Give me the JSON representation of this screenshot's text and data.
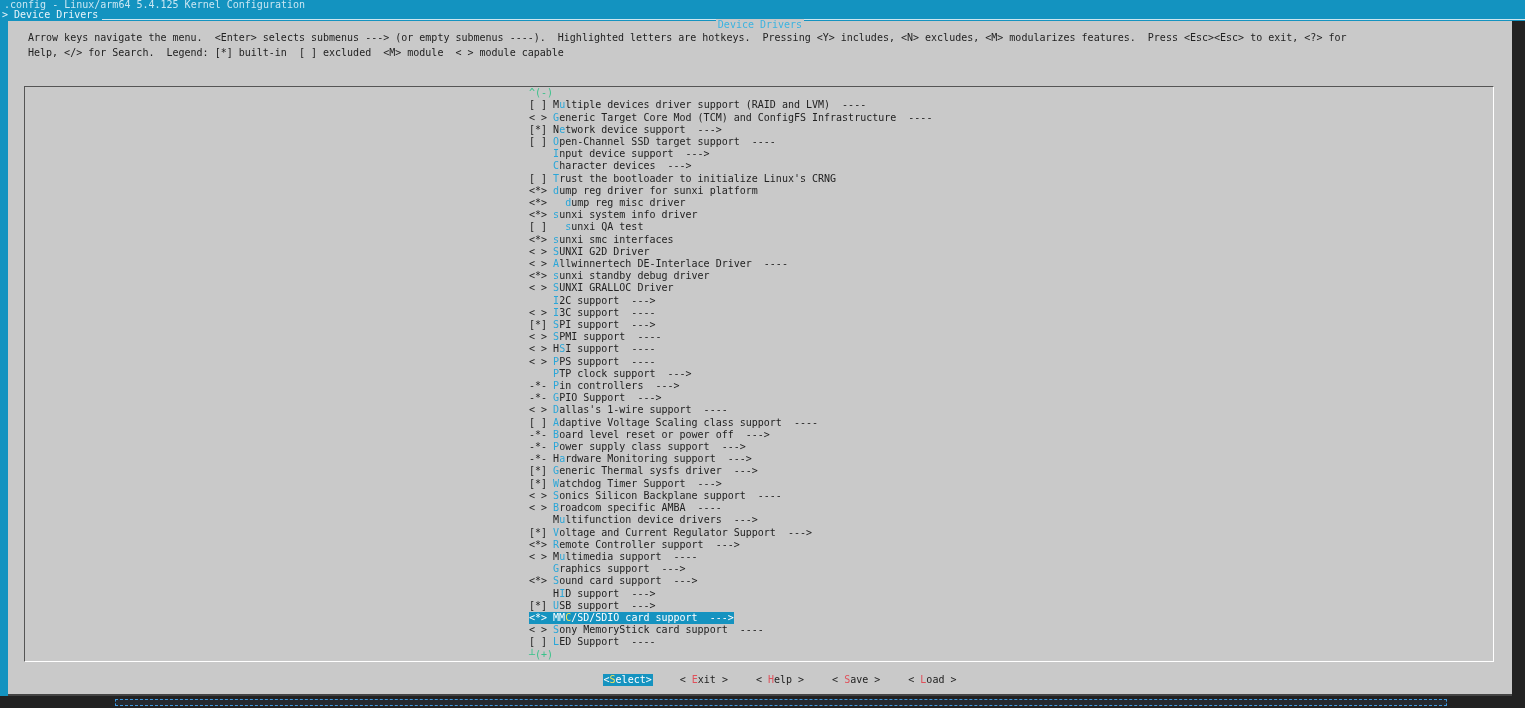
{
  "window": {
    "title": ".config - Linux/arm64 5.4.125 Kernel Configuration",
    "breadcrumb": "> Device Drivers"
  },
  "dialog": {
    "title": "Device Drivers",
    "help_lines": [
      "Arrow keys navigate the menu.  <Enter> selects submenus ---> (or empty submenus ----).  Highlighted letters are hotkeys.  Pressing <Y> includes, <N> excludes, <M> modularizes features.  Press <Esc><Esc> to exit, <?> for",
      "Help, </> for Search.  Legend: [*] built-in  [ ] excluded  <M> module  < > module capable"
    ]
  },
  "menu": {
    "scroll_up": "^(-)",
    "scroll_down": "┴(+)",
    "items": [
      {
        "state": "[ ]",
        "pre": "M",
        "hotkey": "u",
        "rest": "ltiple devices driver support (RAID and LVM)  ----",
        "selected": false
      },
      {
        "state": "< >",
        "hotkey": "G",
        "rest": "eneric Target Core Mod (TCM) and ConfigFS Infrastructure  ----",
        "selected": false
      },
      {
        "state": "[*]",
        "pre": "N",
        "hotkey": "e",
        "rest": "twork device support  --->",
        "selected": false
      },
      {
        "state": "[ ]",
        "hotkey": "O",
        "rest": "pen-Channel SSD target support  ----",
        "selected": false
      },
      {
        "hotkey": "I",
        "rest": "nput device support  --->",
        "selected": false
      },
      {
        "hotkey": "C",
        "rest": "haracter devices  --->",
        "selected": false
      },
      {
        "state": "[ ]",
        "hotkey": "T",
        "rest": "rust the bootloader to initialize Linux's CRNG",
        "selected": false
      },
      {
        "state": "<*>",
        "hotkey": "d",
        "rest": "ump reg driver for sunxi platform",
        "selected": false,
        "children": [
          {
            "state": "<*>",
            "hotkey": "d",
            "rest": "ump reg misc driver",
            "selected": false
          }
        ]
      },
      {
        "state": "<*>",
        "hotkey": "s",
        "rest": "unxi system info driver",
        "selected": false,
        "children": [
          {
            "state": "[ ]",
            "hotkey": "s",
            "rest": "unxi QA test",
            "selected": false
          }
        ]
      },
      {
        "state": "<*>",
        "hotkey": "s",
        "rest": "unxi smc interfaces",
        "selected": false
      },
      {
        "state": "< >",
        "hotkey": "S",
        "rest": "UNXI G2D Driver",
        "selected": false
      },
      {
        "state": "< >",
        "hotkey": "A",
        "rest": "llwinnertech DE-Interlace Driver  ----",
        "selected": false
      },
      {
        "state": "<*>",
        "hotkey": "s",
        "rest": "unxi standby debug driver",
        "selected": false
      },
      {
        "state": "< >",
        "hotkey": "S",
        "rest": "UNXI GRALLOC Driver",
        "selected": false
      },
      {
        "hotkey": "I",
        "rest": "2C support  --->",
        "selected": false
      },
      {
        "state": "< >",
        "hotkey": "I",
        "rest": "3C support  ----",
        "selected": false
      },
      {
        "state": "[*]",
        "hotkey": "S",
        "rest": "PI support  --->",
        "selected": false
      },
      {
        "state": "< >",
        "hotkey": "S",
        "rest": "PMI support  ----",
        "selected": false
      },
      {
        "state": "< >",
        "pre": "H",
        "hotkey": "S",
        "rest": "I support  ----",
        "selected": false
      },
      {
        "state": "< >",
        "hotkey": "P",
        "rest": "PS support  ----",
        "selected": false
      },
      {
        "hotkey": "P",
        "rest": "TP clock support  --->",
        "selected": false
      },
      {
        "state": "-*-",
        "hotkey": "P",
        "rest": "in controllers  --->",
        "selected": false
      },
      {
        "state": "-*-",
        "hotkey": "G",
        "rest": "PIO Support  --->",
        "selected": false
      },
      {
        "state": "< >",
        "hotkey": "D",
        "rest": "allas's 1-wire support  ----",
        "selected": false
      },
      {
        "state": "[ ]",
        "hotkey": "A",
        "rest": "daptive Voltage Scaling class support  ----",
        "selected": false
      },
      {
        "state": "-*-",
        "hotkey": "B",
        "rest": "oard level reset or power off  --->",
        "selected": false
      },
      {
        "state": "-*-",
        "hotkey": "P",
        "rest": "ower supply class support  --->",
        "selected": false
      },
      {
        "state": "-*-",
        "pre": "H",
        "hotkey": "a",
        "rest": "rdware Monitoring support  --->",
        "selected": false
      },
      {
        "state": "[*]",
        "hotkey": "G",
        "rest": "eneric Thermal sysfs driver  --->",
        "selected": false
      },
      {
        "state": "[*]",
        "hotkey": "W",
        "rest": "atchdog Timer Support  --->",
        "selected": false
      },
      {
        "state": "< >",
        "hotkey": "S",
        "rest": "onics Silicon Backplane support  ----",
        "selected": false
      },
      {
        "state": "< >",
        "hotkey": "B",
        "rest": "roadcom specific AMBA  ----",
        "selected": false
      },
      {
        "pre": "M",
        "hotkey": "u",
        "rest": "ltifunction device drivers  --->",
        "selected": false
      },
      {
        "state": "[*]",
        "hotkey": "V",
        "rest": "oltage and Current Regulator Support  --->",
        "selected": false
      },
      {
        "state": "<*>",
        "hotkey": "R",
        "rest": "emote Controller support  --->",
        "selected": false
      },
      {
        "state": "< >",
        "pre": "M",
        "hotkey": "u",
        "rest": "ltimedia support  ----",
        "selected": false
      },
      {
        "hotkey": "G",
        "rest": "raphics support  --->",
        "selected": false
      },
      {
        "state": "<*>",
        "hotkey": "S",
        "rest": "ound card support  --->",
        "selected": false
      },
      {
        "pre": "H",
        "hotkey": "I",
        "rest": "D support  --->",
        "selected": false
      },
      {
        "state": "[*]",
        "hotkey": "U",
        "rest": "SB support  --->",
        "selected": false
      },
      {
        "state": "<*>",
        "pre": "MM",
        "hotkey": "C",
        "rest": "/SD/SDIO card support  --->",
        "selected": true
      },
      {
        "state": "< >",
        "hotkey": "S",
        "rest": "ony MemoryStick card support  ----",
        "selected": false
      },
      {
        "state": "[ ]",
        "hotkey": "L",
        "rest": "ED Support  ----",
        "selected": false
      }
    ]
  },
  "buttons": [
    {
      "pre": "<",
      "hotkey": "S",
      "rest": "elect>",
      "selected": true
    },
    {
      "pre": "< ",
      "hotkey": "E",
      "rest": "xit >",
      "selected": false
    },
    {
      "pre": "< ",
      "hotkey": "H",
      "rest": "elp >",
      "selected": false
    },
    {
      "pre": "< ",
      "hotkey": "S",
      "rest": "ave >",
      "selected": false
    },
    {
      "pre": "< ",
      "hotkey": "L",
      "rest": "oad >",
      "selected": false
    }
  ]
}
